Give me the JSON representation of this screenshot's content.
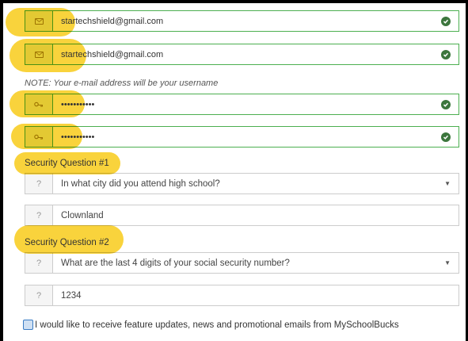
{
  "form": {
    "email": {
      "icon": "envelope-icon",
      "value": "startechshield@gmail.com"
    },
    "email_confirm": {
      "icon": "envelope-icon",
      "value": "startechshield@gmail.com"
    },
    "note": "NOTE: Your e-mail address will be your username",
    "password": {
      "icon": "key-icon",
      "value": "•••••••••••"
    },
    "password_confirm": {
      "icon": "key-icon",
      "value": "•••••••••••"
    },
    "security_q1": {
      "label": "Security Question #1",
      "addon": "?",
      "question": "In what city did you attend high school?",
      "answer": "Clownland"
    },
    "security_q2": {
      "label": "Security Question #2",
      "addon": "?",
      "question": "What are the last 4 digits of your social security number?",
      "answer": "1234"
    },
    "optin_label": "I would like to receive feature updates, news and promotional emails from MySchoolBucks"
  },
  "colors": {
    "valid_border": "#4caf50",
    "valid_check": "#3c763d",
    "highlight": "#f8cc19",
    "checkbox_blue": "#3a7cc4"
  }
}
